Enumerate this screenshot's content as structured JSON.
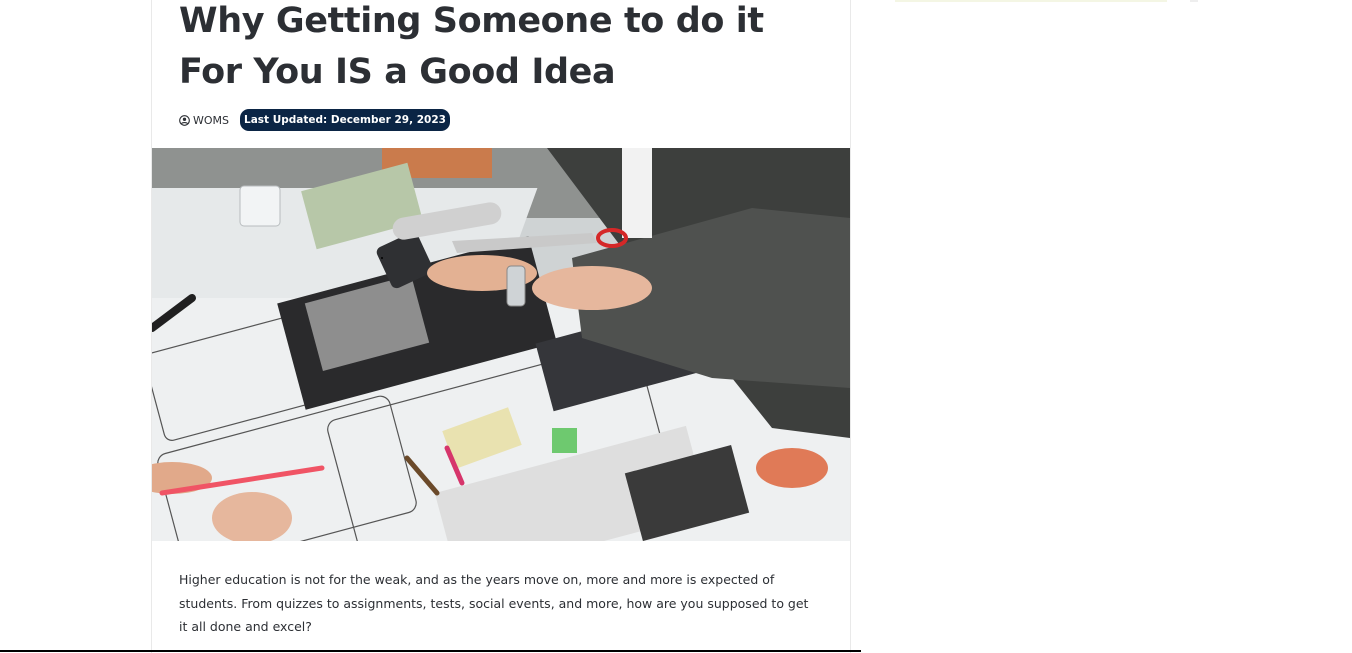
{
  "article": {
    "title": "Why Getting Someone to do it For You IS a Good Idea",
    "author": {
      "icon": "user-circle-icon",
      "name": "WOMS"
    },
    "updated_label": "Last Updated: December 29, 2023",
    "intro": "Higher education is not for the weak, and as the years move on, more and more is expected of students. From quizzes to assignments, tests, social events, and more, how are you supposed to get it all done and excel?"
  },
  "colors": {
    "title": "#2c2f34",
    "badge_bg": "#0b2545",
    "badge_text": "#ffffff"
  }
}
